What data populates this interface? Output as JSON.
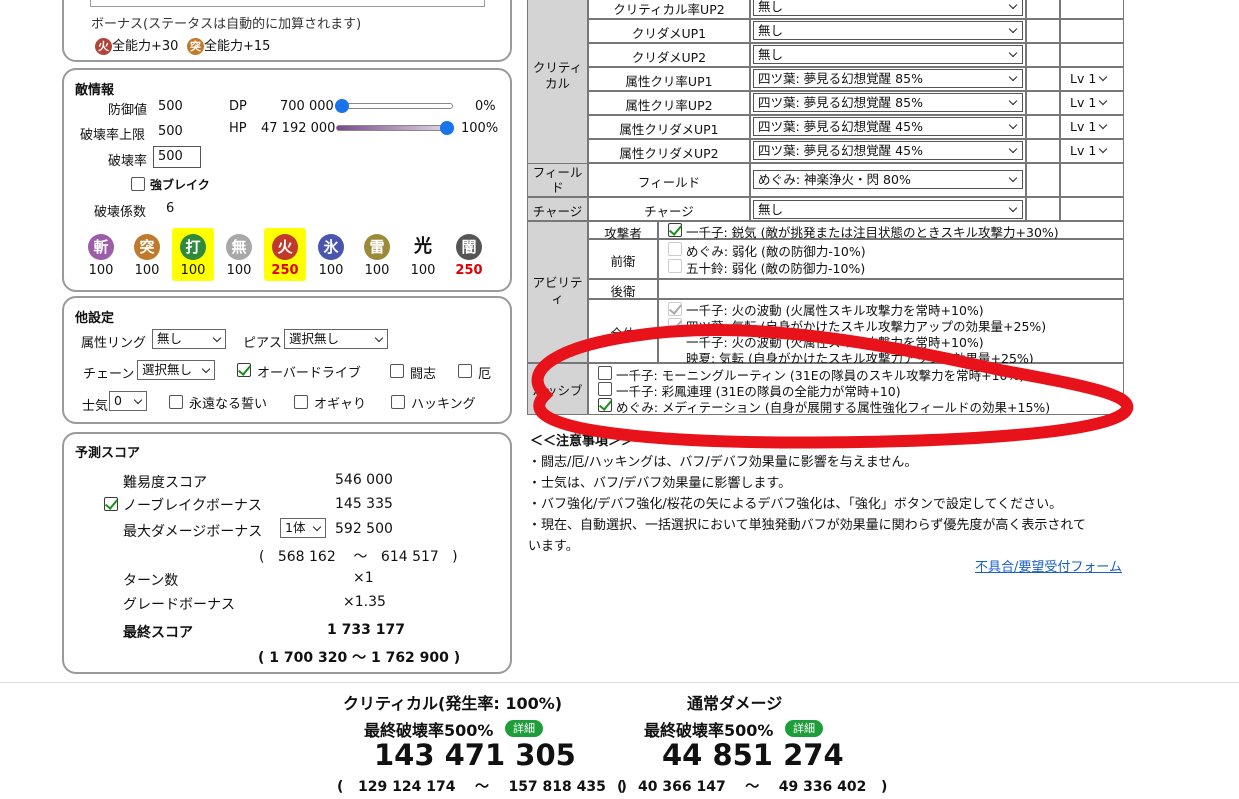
{
  "top_panel": {
    "bonus_label": "ボーナス(ステータスは自動的に加算されます)",
    "bonus_items": [
      {
        "icon": "火",
        "color": "#b0453a",
        "text": "全能力+30"
      },
      {
        "icon": "突",
        "color": "#c07a2b",
        "text": "全能力+15"
      }
    ]
  },
  "enemy": {
    "title": "敵情報",
    "defense_label": "防御値",
    "defense_value": "500",
    "break_limit_label": "破壊率上限",
    "break_limit_value": "500",
    "break_rate_label": "破壊率",
    "break_rate_value": "500",
    "strong_break_label": "強ブレイク",
    "break_coef_label": "破壊係数",
    "break_coef_value": "6",
    "dp_label": "DP",
    "dp_value": "700 000",
    "dp_pct": "0%",
    "dp_fraction": 0,
    "hp_label": "HP",
    "hp_value": "47 192 000",
    "hp_pct": "100%",
    "hp_fraction": 1,
    "elements": [
      {
        "icon": "斬",
        "value": "100",
        "color": "#9b5ca8",
        "highlight": false,
        "red": false
      },
      {
        "icon": "突",
        "value": "100",
        "color": "#c07a2b",
        "highlight": false,
        "red": false
      },
      {
        "icon": "打",
        "value": "100",
        "color": "#2f8a3a",
        "highlight": true,
        "red": false
      },
      {
        "icon": "無",
        "value": "100",
        "color": "#a8a8a8",
        "highlight": false,
        "red": false
      },
      {
        "icon": "火",
        "value": "250",
        "color": "#c0392b",
        "highlight": true,
        "red": true
      },
      {
        "icon": "氷",
        "value": "100",
        "color": "#4a55b0",
        "highlight": false,
        "red": false
      },
      {
        "icon": "雷",
        "value": "100",
        "color": "#9b8a3a",
        "highlight": false,
        "red": false
      },
      {
        "icon": "光",
        "value": "100",
        "color": "none",
        "highlight": false,
        "red": false
      },
      {
        "icon": "闇",
        "value": "250",
        "color": "#555555",
        "highlight": false,
        "red": true
      }
    ]
  },
  "other": {
    "title": "他設定",
    "ring_label": "属性リング",
    "ring_value": "無し",
    "pierce_label": "ピアス",
    "pierce_value": "選択無し",
    "chain_label": "チェーン",
    "chain_value": "選択無し",
    "overdrive_label": "オーバードライブ",
    "toushi_label": "闘志",
    "yaku_label": "厄",
    "morale_label": "士気",
    "morale_value": "0",
    "eternal_label": "永遠なる誓い",
    "ogyari_label": "オギャり",
    "hacking_label": "ハッキング"
  },
  "score": {
    "title": "予測スコア",
    "difficulty_label": "難易度スコア",
    "difficulty_value": "546 000",
    "nobreak_label": "ノーブレイクボーナス",
    "nobreak_value": "145 335",
    "maxdmg_label": "最大ダメージボーナス",
    "maxdmg_select": "1体",
    "maxdmg_value": "592 500",
    "maxdmg_min": "568 162",
    "maxdmg_tilde": "～",
    "maxdmg_max": "614 517",
    "paren_open": "(",
    "paren_close": ")",
    "turn_label": "ターン数",
    "turn_value": "×1",
    "grade_label": "グレードボーナス",
    "grade_value": "×1.35",
    "final_label": "最終スコア",
    "final_value": "1 733 177",
    "final_range": "( 1 700 320 ～ 1 762 900 )"
  },
  "buff_table": {
    "critical_group": "クリティカル",
    "critical_rows": [
      {
        "label": "クリティカル率UP2",
        "value": "無し",
        "lv": ""
      },
      {
        "label": "クリダメUP1",
        "value": "無し",
        "lv": ""
      },
      {
        "label": "クリダメUP2",
        "value": "無し",
        "lv": ""
      },
      {
        "label": "属性クリ率UP1",
        "value": "四ツ葉: 夢見る幻想覚醒 85%",
        "lv": "Lv 1"
      },
      {
        "label": "属性クリ率UP2",
        "value": "四ツ葉: 夢見る幻想覚醒 85%",
        "lv": "Lv 1"
      },
      {
        "label": "属性クリダメUP1",
        "value": "四ツ葉: 夢見る幻想覚醒 45%",
        "lv": "Lv 1"
      },
      {
        "label": "属性クリダメUP2",
        "value": "四ツ葉: 夢見る幻想覚醒 45%",
        "lv": "Lv 1"
      }
    ],
    "field_group": "フィールド",
    "field_label": "フィールド",
    "field_value": "めぐみ: 神楽浄火・閃 80%",
    "charge_group": "チャージ",
    "charge_label": "チャージ",
    "charge_value": "無し",
    "ability_group": "アビリティ",
    "attacker_label": "攻撃者",
    "attacker_item": "一千子: 鋭気 (敵が挑発または注目状態のときスキル攻撃力+30%)",
    "front_label": "前衛",
    "front_items": [
      "めぐみ: 弱化 (敵の防御力-10%)",
      "五十鈴: 弱化 (敵の防御力-10%)"
    ],
    "back_label": "後衛",
    "all_label": "全体",
    "all_items": [
      "一千子: 火の波動 (火属性スキル攻撃力を常時+10%)",
      "四ツ葉: 気転 (自身がかけたスキル攻撃力アップの効果量+25%)",
      "一千子: 火の波動 (火属性スキル攻撃力を常時+10%)",
      "映夏: 気転 (自身がかけたスキル攻撃力アップの効果量+25%)"
    ],
    "passive_group": "パッシブ",
    "passive_items": [
      "一千子: モーニングルーティン (31Eの隊員のスキル攻撃力を常時+10%)",
      "一千子: 彩鳳連理 (31Eの隊員の全能力が常時+10)",
      "めぐみ: メディテーション (自身が展開する属性強化フィールドの効果+15%)"
    ]
  },
  "notes": {
    "header": "＜＜注意事項＞＞",
    "lines": [
      "・闘志/厄/ハッキングは、バフ/デバフ効果量に影響を与えません。",
      "・士気は、バフ/デバフ効果量に影響します。",
      "・バフ強化/デバフ強化/桜花の矢によるデバフ強化は、「強化」ボタンで設定してください。",
      "・現在、自動選択、一括選択において単独発動バフが効果量に関わらず優先度が高く表示されて",
      "います。"
    ],
    "link": "不具合/要望受付フォーム"
  },
  "results": {
    "crit_title": "クリティカル(発生率: 100%)",
    "crit_break": "最終破壊率500%",
    "crit_value": "143 471 305",
    "crit_range_min": "129 124 174",
    "crit_range_max": "157 818 435",
    "normal_title": "通常ダメージ",
    "normal_break": "最終破壊率500%",
    "normal_value": "44 851 274",
    "normal_range_min": "40 366 147",
    "normal_range_max": "49 336 402",
    "detail_label": "詳細",
    "paren_open": "(",
    "paren_close": ")",
    "tilde": "～"
  },
  "colors": {
    "annotation_red": "#e8121a",
    "slider_blue": "#1a73e8",
    "highlight_yellow": "#ffff00",
    "link_blue": "#1a5fc9",
    "badge_green": "#1e9e3a"
  }
}
